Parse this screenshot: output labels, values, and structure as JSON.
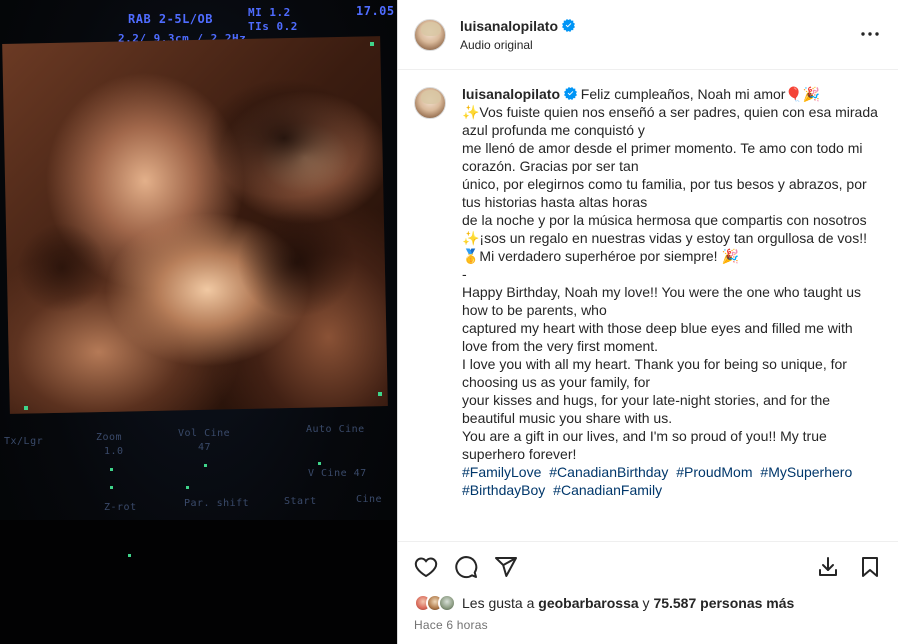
{
  "media": {
    "scan_labels": {
      "top1": "RAB 2-5L/OB",
      "top2": "MI 1.2",
      "top3": "17.05",
      "top4": "2.2/ 9.3cm / 2.2Hz",
      "top5": "TIs 0.2",
      "bottom": [
        "Zoom",
        "Vol Cine",
        "Auto Cine",
        "1.0",
        "47",
        "V Cine 47",
        "Z-rot",
        "Par. shift",
        "Start",
        "Cine"
      ]
    }
  },
  "post": {
    "username": "luisanalopilato",
    "audio": "Audio original",
    "caption_lines": [
      "✨Vos fuiste quien nos enseñó a ser padres, quien con esa mirada azul profunda me conquistó y",
      "me llenó de amor desde el primer momento. Te amo con todo mi corazón. Gracias por ser tan",
      "único, por elegirnos como tu familia, por tus besos y abrazos, por tus historias hasta altas horas",
      "de la noche y por la música hermosa que compartis con nosotros",
      "✨¡sos un regalo en nuestras vidas y estoy tan orgullosa de vos!!",
      "🥇Mi verdadero superhéroe por siempre! 🎉",
      "-",
      "Happy Birthday, Noah my love!! You were the one who taught us how to be parents, who",
      "captured my heart with those deep blue eyes and filled me with love from the very first moment.",
      "I love you with all my heart. Thank you for being so unique, for choosing us as your family, for",
      "your kisses and hugs, for your late-night stories, and for the beautiful music you share with us.",
      "You are a gift in our lives, and I'm so proud of you!! My true superhero forever!"
    ],
    "caption_first": "Feliz cumpleaños, Noah mi amor🎈🎉",
    "hashtags": [
      "#FamilyLove",
      "#CanadianBirthday",
      "#ProudMom",
      "#MySuperhero",
      "#BirthdayBoy",
      "#CanadianFamily"
    ],
    "likes_prefix": "Les gusta a",
    "likes_user": "geobarbarossa",
    "likes_and": "y",
    "likes_count": "75.587 personas más",
    "time": "Hace 6 horas"
  },
  "icons": {
    "verified": "verified-badge-icon",
    "more": "more-options-icon",
    "like": "heart-icon",
    "comment": "comment-icon",
    "share": "share-icon",
    "download": "download-icon",
    "save": "bookmark-icon"
  },
  "colors": {
    "verified": "#0095f6",
    "hashtag": "#00376b",
    "muted": "#737373"
  }
}
